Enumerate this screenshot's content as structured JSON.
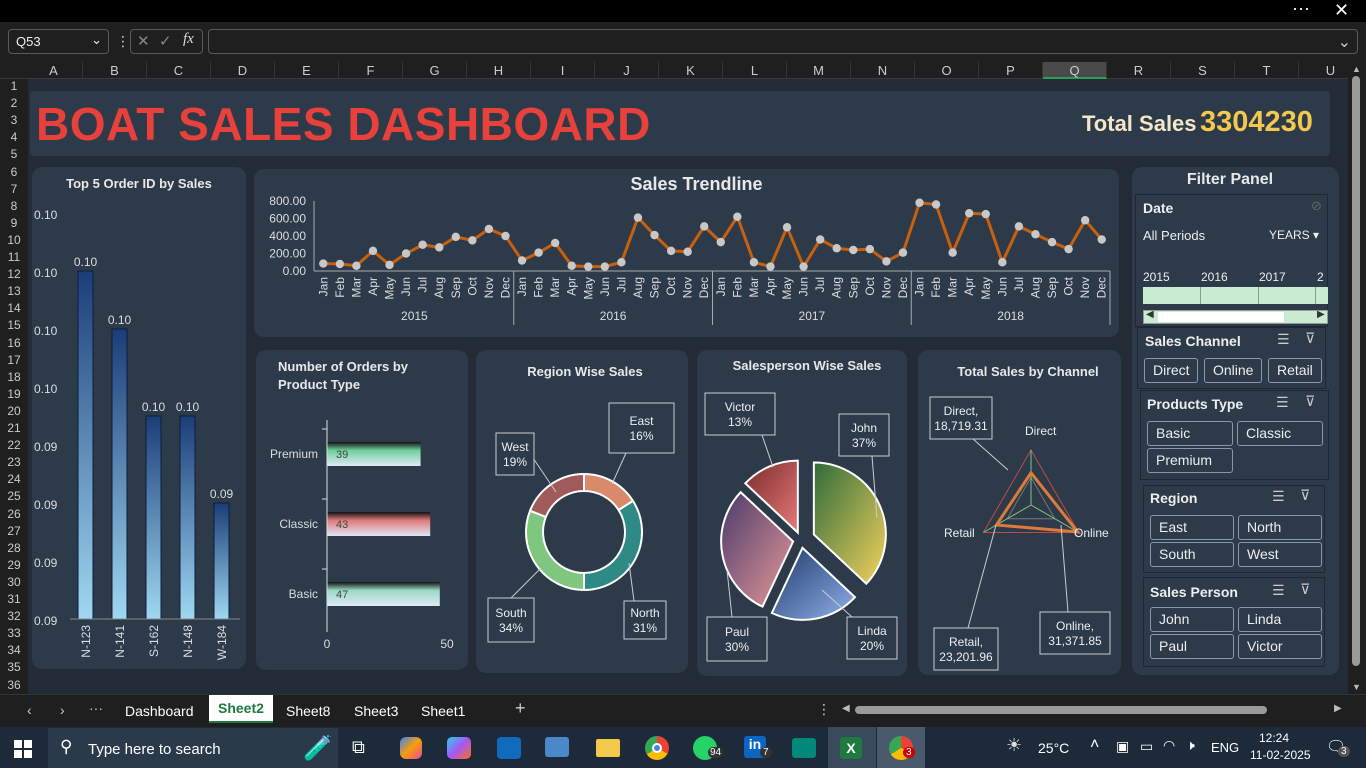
{
  "window": {
    "more_icon": "more-icon",
    "close_icon": "close-icon"
  },
  "formula_bar": {
    "name_box": "Q53",
    "formula": ""
  },
  "columns": [
    "A",
    "B",
    "C",
    "D",
    "E",
    "F",
    "G",
    "H",
    "I",
    "J",
    "K",
    "L",
    "M",
    "N",
    "O",
    "P",
    "Q",
    "R",
    "S",
    "T",
    "U"
  ],
  "rows": [
    "1",
    "2",
    "3",
    "4",
    "5",
    "6",
    "7",
    "8",
    "9",
    "10",
    "11",
    "12",
    "13",
    "14",
    "15",
    "16",
    "17",
    "18",
    "19",
    "20",
    "21",
    "22",
    "23",
    "24",
    "25",
    "26",
    "27",
    "28",
    "29",
    "30",
    "31",
    "32",
    "33",
    "34",
    "35",
    "36"
  ],
  "dashboard": {
    "title": "BOAT SALES DASHBOARD",
    "total_label": "Total Sales",
    "total_value": "3304230",
    "colors": {
      "title": "#e8403a",
      "total": "#f2c94c",
      "trend_line": "#c8600e"
    }
  },
  "top5": {
    "title": "Top 5 Order ID by Sales"
  },
  "trend": {
    "title": "Sales Trendline"
  },
  "orders": {
    "title": "Number of Orders by Product Type"
  },
  "region": {
    "title": "Region Wise Sales"
  },
  "salesperson": {
    "title": "Salesperson Wise Sales"
  },
  "channel": {
    "title": "Total Sales by Channel"
  },
  "chart_data": [
    {
      "type": "bar",
      "categories": [
        "N-123",
        "N-141",
        "S-162",
        "N-148",
        "W-184"
      ],
      "values": [
        0.1,
        0.1,
        0.1,
        0.1,
        0.09
      ],
      "data_labels": [
        "0.10",
        "0.10",
        "0.10",
        "0.10",
        "0.09"
      ],
      "y_ticks": [
        "0.10",
        "0.10",
        "0.10",
        "0.10",
        "0.09",
        "0.09",
        "0.09",
        "0.09"
      ]
    },
    {
      "type": "line",
      "years": [
        "2015",
        "2016",
        "2017",
        "2018"
      ],
      "months": [
        "Jan",
        "Feb",
        "Mar",
        "Apr",
        "May",
        "Jun",
        "Jul",
        "Aug",
        "Sep",
        "Oct",
        "Nov",
        "Dec"
      ],
      "values": [
        85,
        80,
        60,
        230,
        70,
        200,
        300,
        270,
        390,
        350,
        480,
        400,
        120,
        210,
        320,
        60,
        50,
        50,
        100,
        610,
        410,
        230,
        220,
        510,
        330,
        620,
        100,
        50,
        500,
        50,
        360,
        260,
        240,
        250,
        110,
        210,
        780,
        760,
        210,
        660,
        650,
        100,
        510,
        420,
        330,
        250,
        580,
        360
      ],
      "y_ticks": [
        "800.00",
        "600.00",
        "400.00",
        "200.00",
        "0.00"
      ],
      "ylim": [
        0,
        800
      ]
    },
    {
      "type": "bar",
      "orientation": "horizontal",
      "categories": [
        "Premium",
        "Classic",
        "Basic"
      ],
      "values": [
        39,
        43,
        47
      ],
      "x_ticks": [
        "0",
        "50"
      ],
      "xlim": [
        0,
        50
      ],
      "colors": [
        "#6fd19a",
        "#e07a7a",
        "#9ad9c5"
      ]
    },
    {
      "type": "pie",
      "style": "donut",
      "labels": [
        "East",
        "South",
        "North",
        "West"
      ],
      "values": [
        16,
        34,
        31,
        19
      ],
      "label_text": [
        [
          "East",
          "16%"
        ],
        [
          "South",
          "34%"
        ],
        [
          "North",
          "31%"
        ],
        [
          "West",
          "19%"
        ]
      ]
    },
    {
      "type": "pie",
      "labels": [
        "John",
        "Linda",
        "Paul",
        "Victor"
      ],
      "values": [
        37,
        20,
        30,
        13
      ],
      "label_text": [
        [
          "John",
          "37%"
        ],
        [
          "Linda",
          "20%"
        ],
        [
          "Paul",
          "30%"
        ],
        [
          "Victor",
          "13%"
        ]
      ]
    },
    {
      "type": "radar",
      "labels": [
        "Direct",
        "Online",
        "Retail"
      ],
      "values": [
        18719.31,
        31371.85,
        23201.96
      ],
      "label_text": [
        [
          "Direct,",
          "18,719.31"
        ],
        [
          "Online,",
          "31,371.85"
        ],
        [
          "Retail,",
          "23,201.96"
        ]
      ]
    }
  ],
  "filter": {
    "title": "Filter Panel",
    "date": {
      "label": "Date",
      "period": "All Periods",
      "level": "YEARS",
      "years": [
        "2015",
        "2016",
        "2017",
        "2"
      ]
    },
    "sales_channel": {
      "label": "Sales Channel",
      "items": [
        "Direct",
        "Online",
        "Retail"
      ]
    },
    "products_type": {
      "label": "Products Type",
      "items": [
        "Basic",
        "Classic",
        "Premium"
      ]
    },
    "region": {
      "label": "Region",
      "items": [
        "East",
        "North",
        "South",
        "West"
      ]
    },
    "sales_person": {
      "label": "Sales Person",
      "items": [
        "John",
        "Linda",
        "Paul",
        "Victor"
      ]
    }
  },
  "tabs": {
    "items": [
      "Dashboard",
      "Sheet2",
      "Sheet8",
      "Sheet3",
      "Sheet1"
    ],
    "active": "Sheet2"
  },
  "taskbar": {
    "search": "Type here to search",
    "weather": "25°C",
    "lang": "ENG",
    "time": "12:24",
    "date": "11-02-2025",
    "notif": "3",
    "badge_whatsapp": "94",
    "badge_linkedin": "7",
    "badge_chrome2": "3"
  }
}
